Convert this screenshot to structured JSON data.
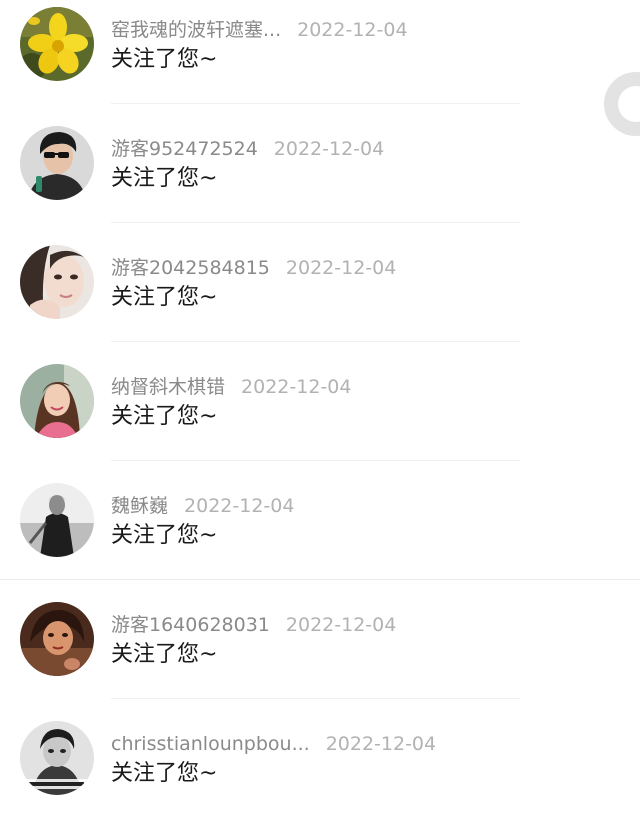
{
  "notifications": [
    {
      "name": "窑我魂的波轩遮塞...",
      "date": "2022-12-04",
      "message": "关注了您~",
      "avatar": "yellow-flower"
    },
    {
      "name": "游客952472524",
      "date": "2022-12-04",
      "message": "关注了您~",
      "avatar": "man-sunglasses"
    },
    {
      "name": "游客2042584815",
      "date": "2022-12-04",
      "message": "关注了您~",
      "avatar": "woman-face"
    },
    {
      "name": "纳督斜木棋错",
      "date": "2022-12-04",
      "message": "关注了您~",
      "avatar": "girl-smiling"
    },
    {
      "name": "魏稣巍",
      "date": "2022-12-04",
      "message": "关注了您~",
      "avatar": "person-bw"
    },
    {
      "name": "游客1640628031",
      "date": "2022-12-04",
      "message": "关注了您~",
      "avatar": "woman-warm"
    },
    {
      "name": "chrisstianlounpbou...",
      "date": "2022-12-04",
      "message": "关注了您~",
      "avatar": "person-bw-text"
    }
  ],
  "colors": {
    "name": "#8a8a8a",
    "date": "#b2b2b2",
    "message": "#1a1a1a"
  }
}
